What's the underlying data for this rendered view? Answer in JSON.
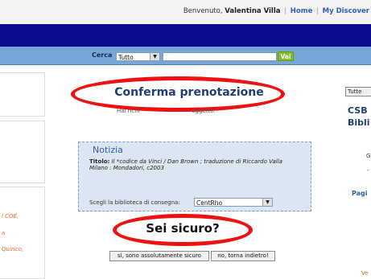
{
  "header": {
    "welcome_prefix": "Benvenuto,",
    "user_name": "Valentina Villa",
    "separator": "|",
    "home_link": "Home",
    "discover_link": "My Discover"
  },
  "search": {
    "label": "Cerca",
    "scope_value": "Tutto",
    "query_value": "",
    "go_label": "Vai"
  },
  "main": {
    "title": "Conferma prenotazione",
    "subtitle_left": "Hai richi",
    "subtitle_right": "oggetto:",
    "record_heading": "Notizia",
    "record_title_label": "Titolo:",
    "record_title_value": "Il *codice da Vinci / Dan Brown ; traduzione di Riccardo Valla",
    "record_publication": "Milano : Mondadori, c2003",
    "branch_label": "Scegli la biblioteca di consegna:",
    "branch_value": "CentRho",
    "confirm_question": "Sei sicuro?",
    "yes_button": "sì, sono assolutamente sicuro",
    "no_button": "no, torna indietro!"
  },
  "left_column": {
    "text_1": "i COE,",
    "text_2": "a",
    "text_3": "Quirico,"
  },
  "right_column": {
    "tutte_label": "Tutte",
    "heading_1": "CSB",
    "heading_2": "Bibli",
    "text_g": "G",
    "text_dash": "-",
    "pagi_label": "Pagi",
    "ve_label": "Ve"
  },
  "icons": {
    "select_arrow": "dropdown-arrow-icon"
  },
  "colors": {
    "top_band": "#0c0a8f",
    "search_band": "#79a6d8",
    "go_button": "#7fbf2e",
    "title_text": "#1f3f73",
    "annotation_red": "#ee1111",
    "record_panel": "#dce6f3"
  }
}
